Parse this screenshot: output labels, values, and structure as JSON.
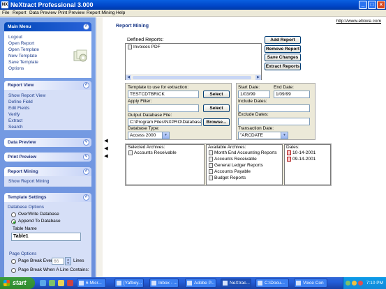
{
  "window": {
    "app_icon": "NX",
    "title": "NeXtract Professional 3.000",
    "controls": [
      "minimize",
      "maximize",
      "close"
    ]
  },
  "menubar": [
    "File",
    "Report",
    "Data Preview",
    "Print Preview",
    "Report Mining",
    "Help"
  ],
  "sidebar": {
    "main_menu": {
      "title": "Main Menu",
      "items": [
        "Logout",
        "Open Report",
        "Open Template",
        "New Template",
        "Save Template",
        "Options"
      ]
    },
    "report_view": {
      "title": "Report View",
      "items": [
        "Show Report View",
        "Define Field",
        "Edit Fields",
        "Verify",
        "Extract",
        "Search"
      ]
    },
    "data_preview": {
      "title": "Data Preview"
    },
    "print_preview": {
      "title": "Print Preview"
    },
    "report_mining": {
      "title": "Report Mining",
      "items": [
        "Show Report Mining"
      ]
    },
    "template_settings": {
      "title": "Template Settings",
      "database_options_label": "Database Options",
      "radio_overwrite": "OverWrite Database",
      "radio_append": "Append To Database",
      "table_name_label": "Table Name",
      "table_name_value": "Table1",
      "page_options_label": "Page Options",
      "radio_page_break_every": "Page Break Every",
      "page_break_every_value": "66",
      "lines_label": "Lines",
      "radio_page_break_when": "Page Break When A Line Contains:"
    }
  },
  "main": {
    "heading": "Report Mining",
    "url": "http://www.ebtore.com",
    "defined_reports": {
      "label": "Defined Reports:",
      "items": [
        "Invoices PDF"
      ]
    },
    "buttons": {
      "add_report": "Add Report",
      "remove_report": "Remove Report",
      "save_changes": "Save Changes",
      "extract_reports": "Extract Reports"
    },
    "form": {
      "template_label": "Template to use for extraction:",
      "template_value": "TESTCDTBRICK",
      "select_label": "Select",
      "apply_filter_label": "Apply Filter:",
      "apply_filter_value": "",
      "select_filter_label": "Select",
      "output_db_label": "Output Database File:",
      "output_db_value": "C:\\Program Files\\NXPRO\\Database\\IN",
      "browse_label": "Browse...",
      "db_type_label": "Database Type:",
      "db_type_value": "Access 2000",
      "start_date_label": "Start Date:",
      "start_date_value": "1/03/99",
      "end_date_label": "End Date:",
      "end_date_value": "1/09/99",
      "include_dates_label": "Include Dates:",
      "exclude_dates_label": "Exclude Dates:",
      "transaction_date_label": "Transaction Date:",
      "transaction_date_value": "\"ARCDATE"
    },
    "selected_archives": {
      "label": "Selected Archives:",
      "items": [
        "Accounts Receivable"
      ]
    },
    "available_archives": {
      "label": "Available Archives:",
      "items": [
        "Month End Accounting Reports",
        "Accounts Receivable",
        "General Ledger Reports",
        "Accounts Payable",
        "Budget Reports"
      ]
    },
    "dates": {
      "label": "Dates:",
      "items": [
        "10-14-2001",
        "09-14-2001"
      ]
    }
  },
  "taskbar": {
    "start_label": "start",
    "tasks": [
      "6 Micr...",
      "[Yafboy...",
      "Inbox - ...",
      "Adobe P...",
      "NeXtrac...",
      "C:\\Docu...",
      "Voice Con"
    ],
    "clock": "7:10 PM"
  }
}
